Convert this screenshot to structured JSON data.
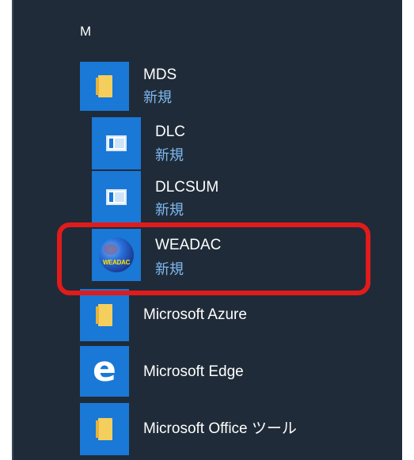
{
  "start_menu": {
    "section_letter": "M",
    "items": [
      {
        "name": "MDS",
        "sub": "新規",
        "icon": "folder-icon"
      },
      {
        "name": "DLC",
        "sub": "新規",
        "icon": "app-window-icon"
      },
      {
        "name": "DLCSUM",
        "sub": "新規",
        "icon": "app-window-icon"
      },
      {
        "name": "WEADAC",
        "sub": "新規",
        "icon": "globe-icon",
        "icon_text": "WEADAC"
      },
      {
        "name": "Microsoft Azure",
        "icon": "folder-icon"
      },
      {
        "name": "Microsoft Edge",
        "icon": "edge-icon",
        "icon_text": "e"
      },
      {
        "name": "Microsoft Office ツール",
        "icon": "folder-icon"
      }
    ]
  },
  "colors": {
    "background": "#1f2b38",
    "tile": "#1a78d6",
    "subtext": "#7fb8f0",
    "highlight": "#e11b1b"
  }
}
